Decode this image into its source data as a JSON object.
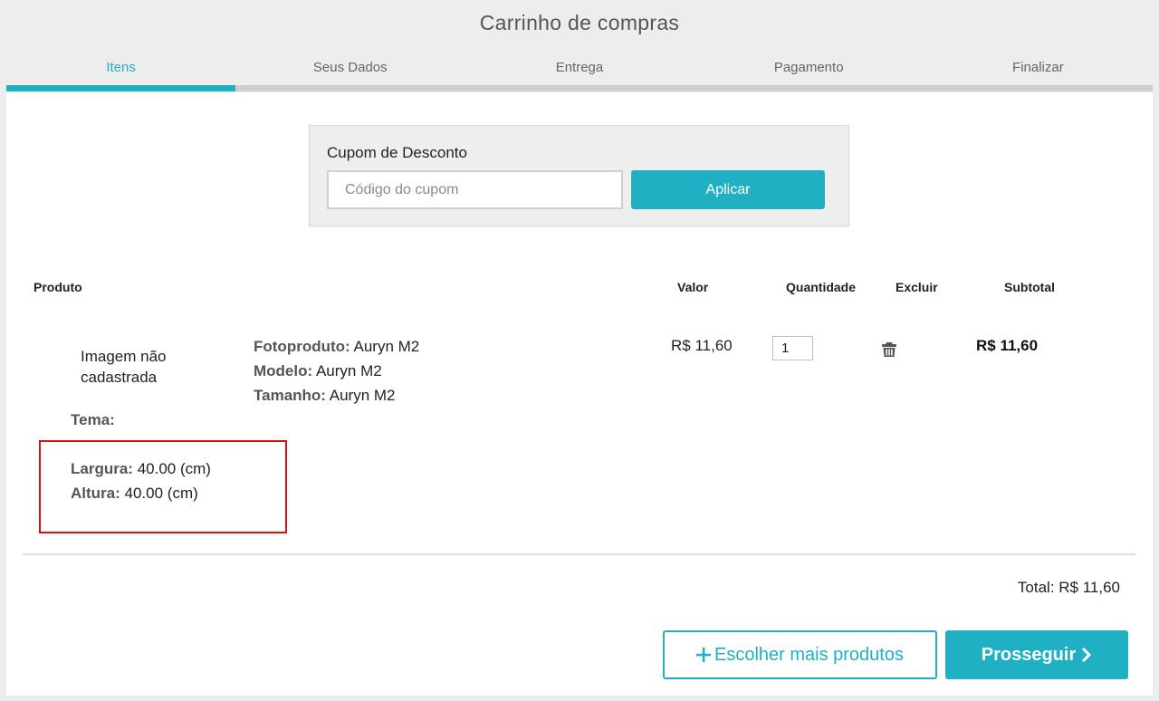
{
  "header": {
    "title": "Carrinho de compras"
  },
  "steps": [
    {
      "label": "Itens",
      "active": true
    },
    {
      "label": "Seus Dados",
      "active": false
    },
    {
      "label": "Entrega",
      "active": false
    },
    {
      "label": "Pagamento",
      "active": false
    },
    {
      "label": "Finalizar",
      "active": false
    }
  ],
  "coupon": {
    "title": "Cupom de Desconto",
    "placeholder": "Código do cupom",
    "value": "",
    "apply_label": "Aplicar"
  },
  "table": {
    "headers": {
      "product": "Produto",
      "value": "Valor",
      "quantity": "Quantidade",
      "delete": "Excluir",
      "subtotal": "Subtotal"
    }
  },
  "item": {
    "no_image": "Imagem não cadastrada",
    "fotoproduto_label": "Fotoproduto:",
    "fotoproduto_value": "Auryn M2",
    "modelo_label": "Modelo:",
    "modelo_value": "Auryn M2",
    "tamanho_label": "Tamanho:",
    "tamanho_value": "Auryn M2",
    "tema_label": "Tema:",
    "largura_label": "Largura:",
    "largura_value": "40.00 (cm)",
    "altura_label": "Altura:",
    "altura_value": "40.00 (cm)",
    "price": "R$ 11,60",
    "quantity": "1",
    "subtotal": "R$ 11,60",
    "delete_icon": "trash-icon"
  },
  "total": {
    "text": "Total: R$ 11,60"
  },
  "actions": {
    "more_label": "Escolher mais produtos",
    "next_label": "Prosseguir"
  },
  "colors": {
    "accent": "#1fb0c3",
    "highlight": "#e01010",
    "background": "#ededed"
  }
}
